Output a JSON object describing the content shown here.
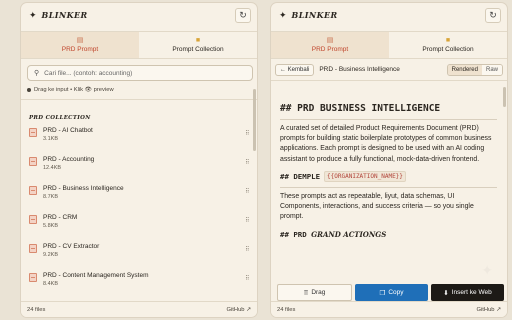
{
  "app": {
    "brand": "BLINKER",
    "brand_icon": "✦",
    "refresh_icon": "↻"
  },
  "tabs": [
    {
      "label": "PRD Prompt",
      "icon": "clipboard-icon"
    },
    {
      "label": "Prompt Collection",
      "icon": "folder-icon"
    }
  ],
  "left": {
    "search": {
      "placeholder": "Cari file... (contoh: accounting)"
    },
    "hint": "Drag ke input • Klik 👁 preview",
    "section_label": "PRD COLLECTION",
    "items": [
      {
        "title": "PRD - AI Chatbot",
        "size": "3.1KB"
      },
      {
        "title": "PRD - Accounting",
        "size": "12.4KB"
      },
      {
        "title": "PRD - Business Intelligence",
        "size": "8.7KB"
      },
      {
        "title": "PRD - CRM",
        "size": "5.8KB"
      },
      {
        "title": "PRD - CV Extractor",
        "size": "9.2KB"
      },
      {
        "title": "PRD - Content Management System",
        "size": "8.4KB"
      }
    ],
    "footer": {
      "count": "24 files",
      "link": "GitHub ↗"
    }
  },
  "right": {
    "back_label": "← Kembali",
    "doc_title": "PRD - Business Intelligence",
    "view_modes": {
      "rendered": "Rendered",
      "raw": "Raw"
    },
    "doc": {
      "h1": "## PRD BUSINESS INTELLIGENCE",
      "p1": "A curated set of detailed Product Requirements Document (PRD) prompts for building static boilerplate prototypes of common business applications. Each prompt is designed to be used with an AI coding assistant to produce a fully functional, mock-data-driven frontend.",
      "h2": "## DEMPLE",
      "h2_code": "{{ORGANIZATION_NAME}}",
      "p2": "These prompts act as repeatable, liyut, data schemas, UI Components, interactions, and success criteria — so you single prompt.",
      "h3": "## PRD",
      "h3_italic": "GRAND ACTIONGS"
    },
    "actions": {
      "drag": "Drag",
      "copy": "Copy",
      "insert": "Insert ke Web"
    },
    "footer": {
      "count": "24 files",
      "link": "GitHub ↗"
    }
  },
  "colors": {
    "accent": "#c0452b",
    "copy_button": "#1f6fb8",
    "insert_button": "#1d1a16",
    "background": "#eae3d5"
  }
}
